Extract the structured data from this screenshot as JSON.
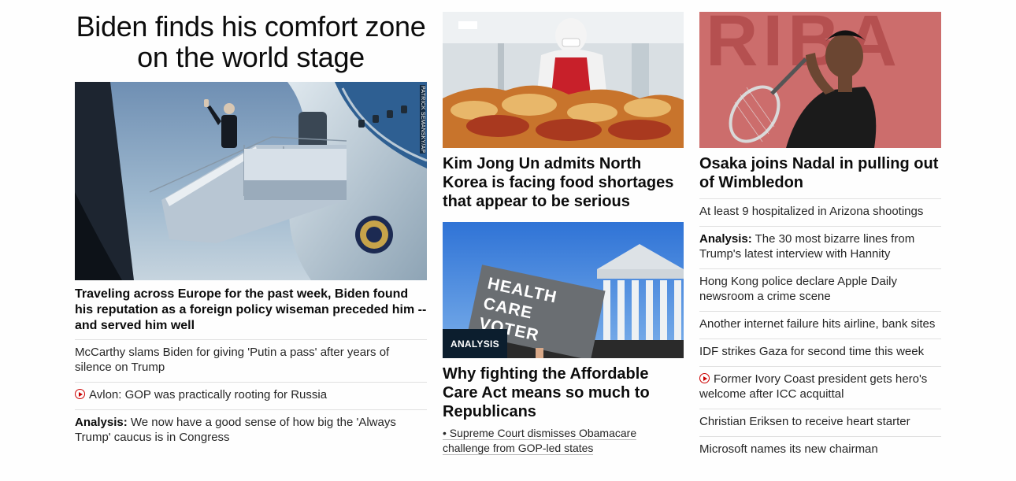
{
  "col1": {
    "hero_title": "Biden finds his comfort zone on the world stage",
    "photo_credit": "PATRICK SEMANSKY/AP",
    "lead": "Traveling across Europe for the past week, Biden found his reputation as a foreign policy wiseman preceded him -- and served him well",
    "links": [
      {
        "label": "",
        "video": false,
        "text": "McCarthy slams Biden for giving 'Putin a pass' after years of silence on Trump"
      },
      {
        "label": "",
        "video": true,
        "text": "Avlon: GOP was practically rooting for Russia"
      },
      {
        "label": "Analysis:",
        "video": false,
        "text": "We now have a good sense of how big the 'Always Trump' caucus is in Congress"
      }
    ]
  },
  "col2": {
    "story1_headline": "Kim Jong Un admits North Korea is facing food shortages that appear to be serious",
    "story2_badge": "ANALYSIS",
    "sign_text": "HEALTH CARE VOTER",
    "story2_headline": "Why fighting the Affordable Care Act means so much to Republicans",
    "story2_sub": "• Supreme Court dismisses Obamacare challenge from GOP-led states"
  },
  "col3": {
    "headline": "Osaka joins Nadal in pulling out of Wimbledon",
    "bg_letters": "RIBA",
    "links": [
      {
        "label": "",
        "video": false,
        "text": "At least 9 hospitalized in Arizona shootings"
      },
      {
        "label": "Analysis:",
        "video": false,
        "text": "The 30 most bizarre lines from Trump's latest interview with Hannity"
      },
      {
        "label": "",
        "video": false,
        "text": "Hong Kong police declare Apple Daily newsroom a crime scene"
      },
      {
        "label": "",
        "video": false,
        "text": "Another internet failure hits airline, bank sites"
      },
      {
        "label": "",
        "video": false,
        "text": "IDF strikes Gaza for second time this week"
      },
      {
        "label": "",
        "video": true,
        "text": "Former Ivory Coast president gets hero's welcome after ICC acquittal"
      },
      {
        "label": "",
        "video": false,
        "text": "Christian Eriksen to receive heart starter"
      },
      {
        "label": "",
        "video": false,
        "text": "Microsoft names its new chairman"
      }
    ]
  },
  "colors": {
    "video_red": "#cc0000",
    "badge_bg": "#0c1e2e"
  }
}
